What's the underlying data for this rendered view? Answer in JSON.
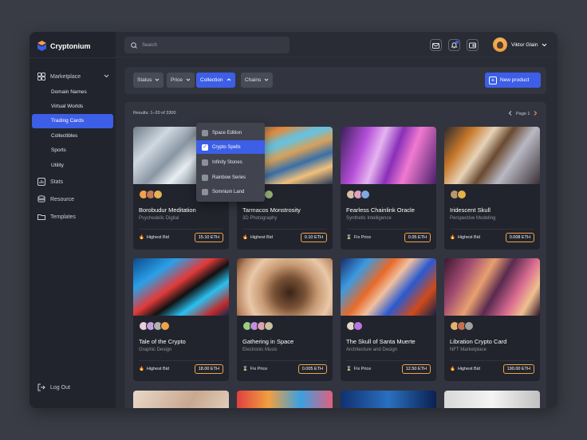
{
  "app": {
    "name": "Cryptonium"
  },
  "sidebar": {
    "marketplace": "Marketplace",
    "sub_items": [
      "Domain Names",
      "Virtual Worlds",
      "Trading Cards",
      "Collectibles",
      "Sports",
      "Utility"
    ],
    "active_sub": "Trading Cards",
    "stats": "Stats",
    "resource": "Resource",
    "templates": "Templates",
    "logout": "Log Out"
  },
  "topbar": {
    "search_placeholder": "Search",
    "user_name": "Viktor Glain"
  },
  "filters": {
    "status": "Status",
    "price": "Price",
    "collection": "Collection",
    "chains": "Chains",
    "new_product": "New product"
  },
  "dropdown": {
    "items": [
      "Space Edition",
      "Crypto Spells",
      "Infinity Stones",
      "Rainbow Series",
      "Somnium Land"
    ],
    "selected": "Crypto Spells"
  },
  "results": {
    "text": "Results: 1–20 of 3300",
    "page": "Page 1"
  },
  "cards": [
    {
      "title": "Borobudur Meditation",
      "subtitle": "Psychedelic Digital",
      "bid_label": "Highest Bid",
      "price": "15.10 ETH",
      "icon": "fire-icon"
    },
    {
      "title": "Tarmacos Monstrosity",
      "subtitle": "3D Photography",
      "bid_label": "Highest Bid",
      "price": "0.10 ETH",
      "icon": "fire-icon"
    },
    {
      "title": "Fearless Chainlink Oracle",
      "subtitle": "Synthetic Intelligence",
      "bid_label": "Fix Price",
      "price": "0.05 ETH",
      "icon": "hourglass-icon"
    },
    {
      "title": "Iridescent Skull",
      "subtitle": "Perspective Modeling",
      "bid_label": "Highest Bid",
      "price": "0.008 ETH",
      "icon": "fire-icon"
    },
    {
      "title": "Tale of the Crypto",
      "subtitle": "Graphic Design",
      "bid_label": "Highest Bid",
      "price": "18.00 ETH",
      "icon": "fire-icon"
    },
    {
      "title": "Gathering in Space",
      "subtitle": "Electronic Music",
      "bid_label": "Fix Price",
      "price": "0.005 ETH",
      "icon": "hourglass-icon"
    },
    {
      "title": "The Skull of Santa Muerte",
      "subtitle": "Architecture and Design",
      "bid_label": "Fix Price",
      "price": "12.50 ETH",
      "icon": "hourglass-icon"
    },
    {
      "title": "Libration Crypto Card",
      "subtitle": "NFT Marketplace",
      "bid_label": "Highest Bid",
      "price": "190.00 ETH",
      "icon": "fire-icon"
    }
  ],
  "colors": {
    "accent": "#3d5ee6",
    "price_border": "#f0a24a",
    "bg": "#292c35"
  }
}
